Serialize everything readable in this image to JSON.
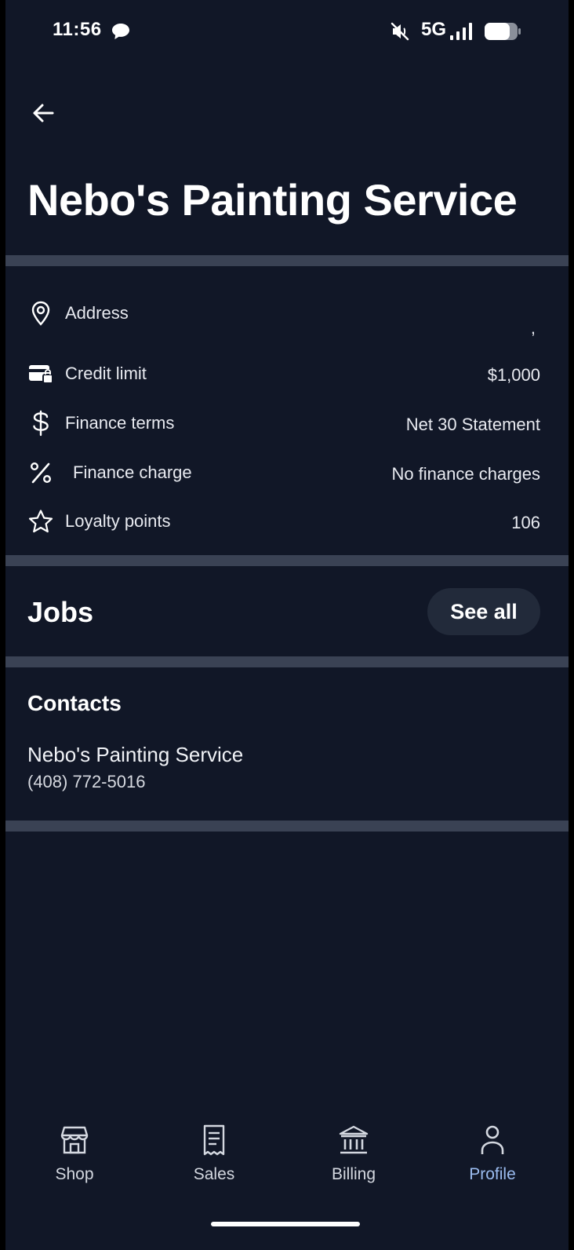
{
  "status_bar": {
    "time": "11:56",
    "network": "5G"
  },
  "page": {
    "title": "Nebo's Painting Service"
  },
  "info": {
    "address_label": "Address",
    "address_value": ",",
    "credit_limit_label": "Credit limit",
    "credit_limit_value": "$1,000",
    "finance_terms_label": "Finance terms",
    "finance_terms_value": "Net 30 Statement",
    "finance_charge_label": "Finance charge",
    "finance_charge_value": "No finance charges",
    "loyalty_label": "Loyalty points",
    "loyalty_value": "106"
  },
  "jobs": {
    "title": "Jobs",
    "see_all_label": "See all"
  },
  "contacts": {
    "title": "Contacts",
    "items": [
      {
        "name": "Nebo's Painting Service",
        "phone": "(408) 772-5016"
      }
    ]
  },
  "nav": {
    "items": [
      {
        "label": "Shop",
        "icon": "storefront-icon"
      },
      {
        "label": "Sales",
        "icon": "receipt-icon"
      },
      {
        "label": "Billing",
        "icon": "bank-icon"
      },
      {
        "label": "Profile",
        "icon": "person-icon",
        "active": true
      }
    ]
  },
  "colors": {
    "background": "#111727",
    "divider": "#3a4254",
    "active_nav": "#9bbcf0",
    "pill_button": "#222a3a"
  }
}
